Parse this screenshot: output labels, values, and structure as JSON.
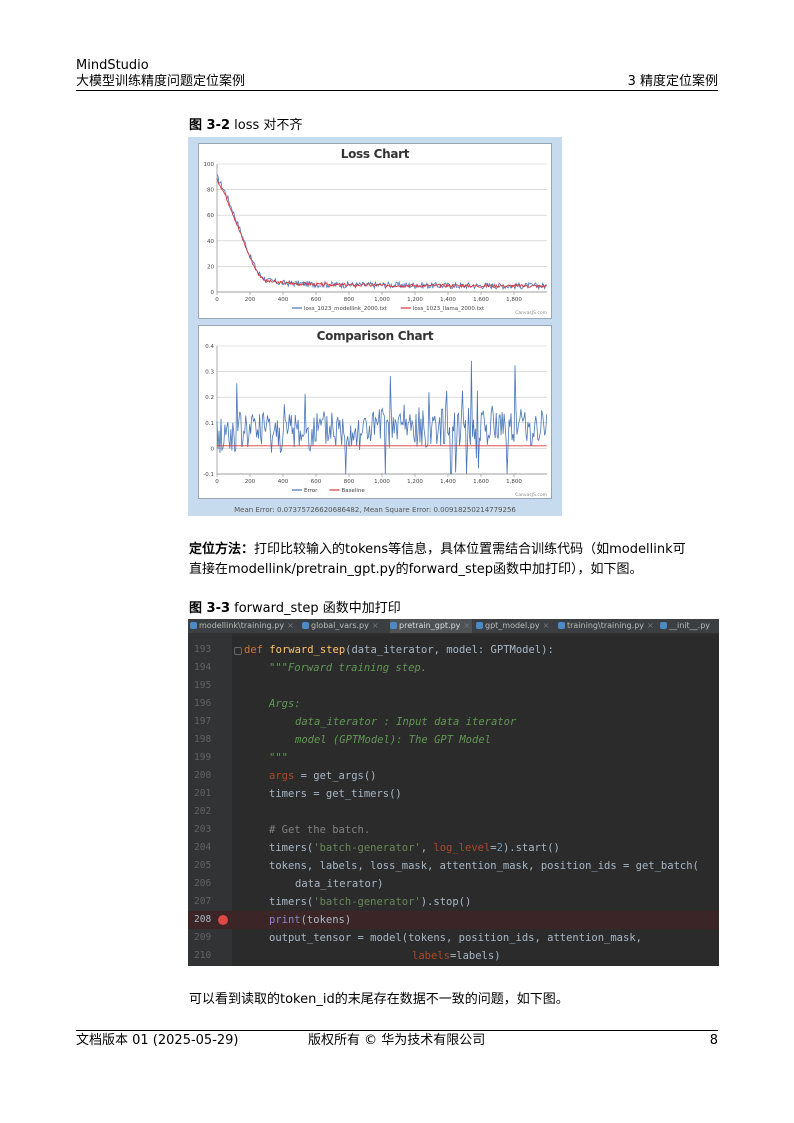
{
  "header": {
    "product": "MindStudio",
    "doc_title": "大模型训练精度问题定位案例",
    "section": "3 精度定位案例"
  },
  "figure1": {
    "number": "图 3-2",
    "title": "loss 对不齐"
  },
  "chart_data": [
    {
      "type": "line",
      "title": "Loss Chart",
      "x": [
        0,
        50,
        100,
        150,
        200,
        250,
        300,
        400,
        600,
        800,
        1000,
        1200,
        1400,
        1600,
        1800,
        2000
      ],
      "series": [
        {
          "name": "loss_1023_modellink_2000.txt",
          "values": [
            90,
            78,
            62,
            45,
            28,
            15,
            9,
            7,
            6,
            5.5,
            5.5,
            5.2,
            5,
            5,
            4.8,
            4.8
          ]
        },
        {
          "name": "loss_1023_llama_2000.txt",
          "values": [
            88,
            76,
            60,
            43,
            27,
            14,
            8.5,
            7,
            6,
            5.5,
            5.2,
            5,
            5,
            4.8,
            4.8,
            4.7
          ]
        }
      ],
      "xlim": [
        0,
        2000
      ],
      "ylim": [
        0,
        100
      ],
      "xticks": [
        "0",
        "200",
        "400",
        "600",
        "800",
        "1,000",
        "1,200",
        "1,400",
        "1,600",
        "1,800"
      ],
      "yticks": [
        "0",
        "20",
        "40",
        "60",
        "80",
        "100"
      ],
      "colors": [
        "#4a76b8",
        "#d9363e"
      ],
      "watermark": "CanvasJS.com",
      "grid": true,
      "legend": "bottom"
    },
    {
      "type": "line",
      "title": "Comparison Chart",
      "x": [
        0,
        200,
        400,
        600,
        800,
        1000,
        1200,
        1400,
        1600,
        1800,
        2000
      ],
      "series": [
        {
          "name": "Error",
          "values": [
            0.05,
            0.07,
            0.06,
            0.07,
            0.07,
            0.08,
            0.08,
            0.09,
            0.09,
            0.09,
            0.08
          ]
        },
        {
          "name": "Baseline",
          "values": [
            0.01,
            0.01,
            0.01,
            0.01,
            0.01,
            0.01,
            0.01,
            0.01,
            0.01,
            0.01,
            0.01
          ]
        }
      ],
      "xlim": [
        0,
        2000
      ],
      "ylim": [
        -0.1,
        0.4
      ],
      "xticks": [
        "0",
        "200",
        "400",
        "600",
        "800",
        "1,000",
        "1,200",
        "1,400",
        "1,600",
        "1,800"
      ],
      "yticks": [
        "-0.1",
        "0",
        "0.1",
        "0.2",
        "0.3",
        "0.4"
      ],
      "colors": [
        "#4a76b8",
        "#d9363e"
      ],
      "watermark": "CanvasJS.com",
      "grid": true,
      "legend": "bottom",
      "footer": "Mean Error: 0.07375726620686482, Mean Square Error: 0.00918250214779256"
    }
  ],
  "paragraph1": {
    "bold": "定位方法：",
    "line1": "打印比较输入的tokens等信息，具体位置需结合训练代码（如modellink可",
    "line2": "直接在modellink/pretrain_gpt.py的forward_step函数中加打印），如下图。"
  },
  "figure2": {
    "number": "图 3-3",
    "title": "forward_step 函数中加打印"
  },
  "code": {
    "tabs": [
      "modellink\\training.py",
      "global_vars.py",
      "pretrain_gpt.py",
      "gpt_model.py",
      "training\\training.py",
      "__init__.py"
    ],
    "active_tab": "pretrain_gpt.py",
    "line_numbers": [
      "193",
      "194",
      "195",
      "196",
      "197",
      "198",
      "199",
      "200",
      "201",
      "202",
      "203",
      "204",
      "205",
      "206",
      "207",
      "208",
      "209",
      "210"
    ],
    "lines": [
      [
        "def ",
        "forward_step",
        "(data_iterator, model: GPTModel):"
      ],
      [
        "\"\"\"Forward training step."
      ],
      [
        ""
      ],
      [
        "Args:"
      ],
      [
        "data_iterator : Input data iterator"
      ],
      [
        "model (GPTModel): The GPT Model"
      ],
      [
        "\"\"\""
      ],
      [
        "args",
        " = get_args()"
      ],
      [
        "timers = get_timers()"
      ],
      [
        ""
      ],
      [
        "# Get the batch."
      ],
      [
        "timers(",
        "'batch-generator'",
        ", ",
        "log_level",
        "=",
        "2",
        ").start()"
      ],
      [
        "tokens, labels, loss_mask, attention_mask, position_ids = get_batch("
      ],
      [
        "data_iterator)"
      ],
      [
        "timers(",
        "'batch-generator'",
        ").stop()"
      ],
      [
        "print",
        "(tokens)"
      ],
      [
        "output_tensor = model(tokens, position_ids, attention_mask,"
      ],
      [
        "labels",
        "=labels)"
      ]
    ]
  },
  "paragraph2": "可以看到读取的token_id的末尾存在数据不一致的问题，如下图。",
  "footer": {
    "version": "文档版本 01 (2025-05-29)",
    "copyright": "版权所有 © 华为技术有限公司",
    "page": "8"
  }
}
